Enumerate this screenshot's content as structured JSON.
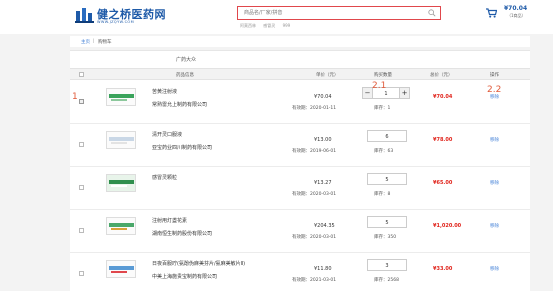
{
  "header": {
    "logo_text": "健之桥医药网",
    "logo_url": "WWW.JZQYW.COM",
    "search_placeholder": "商品名/厂家/拼音",
    "hot_links": [
      "阿莫西林",
      "感冒灵",
      "999"
    ],
    "cart_total": "¥70.04",
    "cart_count": "（1商品）"
  },
  "breadcrumb": {
    "home": "主页",
    "separator": "|",
    "current": "购物车"
  },
  "shop_name": "广药大众",
  "table": {
    "headers": {
      "product": "药品信息",
      "price": "单价（元）",
      "quantity": "购买数量",
      "total": "总价（元）",
      "action": "操作"
    },
    "rows": [
      {
        "checked": true,
        "name": "苦黄注射液",
        "manufacturer": "常熟雷允上制药有限公司",
        "price": "¥70.04",
        "expiry": "有效期：2020-01-11",
        "quantity": "1",
        "stock": "库存：1",
        "total": "¥70.04",
        "action": "移除",
        "stepper": true
      },
      {
        "checked": false,
        "name": "清开灵口服液",
        "manufacturer": "亚宝药业四川制药有限公司",
        "price": "¥13.00",
        "expiry": "有效期：2019-06-01",
        "quantity": "6",
        "stock": "库存：63",
        "total": "¥78.00",
        "action": "移除",
        "stepper": false
      },
      {
        "checked": false,
        "name": "感冒灵颗粒",
        "manufacturer": "",
        "price": "¥13.27",
        "expiry": "有效期：2020-03-01",
        "quantity": "5",
        "stock": "库存：8",
        "total": "¥65.00",
        "action": "移除",
        "stepper": false
      },
      {
        "checked": false,
        "name": "注射用灯盏花素",
        "manufacturer": "湖南恒生制药股份有限公司",
        "price": "¥204.35",
        "expiry": "有效期：2020-03-01",
        "quantity": "5",
        "stock": "库存：350",
        "total": "¥1,020.00",
        "action": "移除",
        "stepper": false
      },
      {
        "checked": false,
        "name": "日夜百服咛(氨酚伪麻美芬片/氨麻美敏片Ⅱ)",
        "manufacturer": "中美上海施贵宝制药有限公司",
        "price": "¥11.80",
        "expiry": "有效期：2021-03-01",
        "quantity": "3",
        "stock": "库存：2568",
        "total": "¥33.00",
        "action": "移除",
        "stepper": false
      }
    ]
  },
  "annotations": {
    "a1": "1",
    "a21": "2.1",
    "a22": "2.2"
  },
  "colors": {
    "brand": "#1e5aa8",
    "accent_red": "#e0231b",
    "link": "#3a7bd5",
    "annotation": "#e05a3a"
  }
}
